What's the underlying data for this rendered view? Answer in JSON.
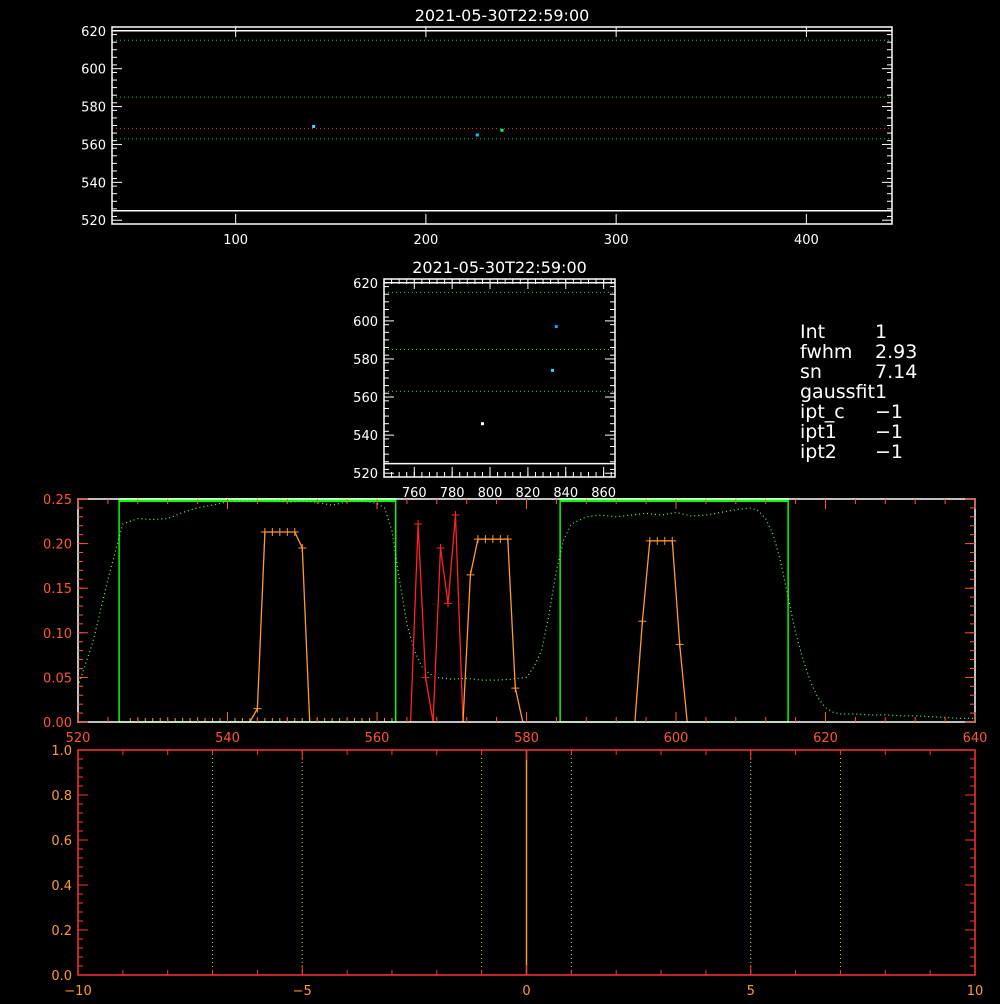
{
  "chart_data": [
    {
      "type": "scatter",
      "title": "2021-05-30T22:59:00",
      "xlim": [
        35,
        445
      ],
      "ylim": [
        518,
        622
      ],
      "xticks": [
        100,
        200,
        300,
        400
      ],
      "yticks": [
        520,
        540,
        560,
        580,
        600,
        620
      ],
      "frame_color": "#ffffff",
      "hlines": [
        {
          "y": 615,
          "color": "#00cc44",
          "style": "dotted"
        },
        {
          "y": 585,
          "color": "#00cc44",
          "style": "dotted"
        },
        {
          "y": 568.5,
          "color": "#ff3333",
          "style": "dotted"
        },
        {
          "y": 563,
          "color": "#00cc44",
          "style": "dotted"
        },
        {
          "y": 620,
          "color": "#ffffff",
          "style": "solid"
        },
        {
          "y": 525,
          "color": "#ffffff",
          "style": "solid"
        }
      ],
      "points": [
        {
          "x": 141,
          "y": 569.5,
          "color": "#66ccff"
        },
        {
          "x": 227,
          "y": 565,
          "color": "#00ccff"
        },
        {
          "x": 240,
          "y": 567.5,
          "color": "#00ff66"
        }
      ]
    },
    {
      "type": "scatter",
      "title": "2021-05-30T22:59:00",
      "xlim": [
        744,
        866
      ],
      "ylim": [
        518,
        622
      ],
      "xticks": [
        760,
        780,
        800,
        820,
        840,
        860
      ],
      "yticks": [
        520,
        540,
        560,
        580,
        600,
        620
      ],
      "frame_color": "#ffffff",
      "hlines": [
        {
          "y": 615,
          "color": "#00cc44",
          "style": "dotted"
        },
        {
          "y": 585,
          "color": "#00cc44",
          "style": "dotted"
        },
        {
          "y": 563,
          "color": "#00cc44",
          "style": "dotted"
        },
        {
          "y": 620,
          "color": "#ffffff",
          "style": "solid"
        },
        {
          "y": 525,
          "color": "#ffffff",
          "style": "solid"
        }
      ],
      "points": [
        {
          "x": 835,
          "y": 597,
          "color": "#3399ff"
        },
        {
          "x": 833,
          "y": 574,
          "color": "#33ccff"
        },
        {
          "x": 796,
          "y": 546,
          "color": "#ffffff"
        }
      ]
    },
    {
      "type": "line",
      "xlim": [
        520,
        640
      ],
      "ylim": [
        0,
        0.25
      ],
      "xticks": [
        520,
        540,
        560,
        580,
        600,
        620,
        640
      ],
      "yticks": [
        0.0,
        0.05,
        0.1,
        0.15,
        0.2,
        0.25
      ],
      "ytick_labels": [
        "0.00",
        "0.05",
        "0.10",
        "0.15",
        "0.20",
        "0.25"
      ],
      "frame_color": "#ffffff",
      "axis_color": "#ff5533",
      "boxes": [
        {
          "x0": 525.5,
          "x1": 562.5,
          "color": "#00ff00"
        },
        {
          "x0": 584.5,
          "x1": 615,
          "color": "#00ff00"
        }
      ],
      "series": [
        {
          "style": "dotted",
          "color": "#66ff66",
          "x": [
            520,
            522,
            524,
            526,
            528,
            530,
            532,
            534,
            536,
            538,
            540,
            542,
            544,
            546,
            548,
            550,
            552,
            554,
            556,
            558,
            560,
            561,
            562,
            563,
            564,
            565,
            566,
            567,
            568,
            570,
            572,
            574,
            576,
            578,
            580,
            581,
            582,
            583,
            584,
            585,
            586,
            588,
            590,
            592,
            594,
            596,
            598,
            600,
            602,
            604,
            606,
            608,
            610,
            611,
            612,
            613,
            614,
            615,
            616,
            617,
            618,
            619,
            620,
            621,
            622,
            624,
            626,
            628,
            630,
            632,
            634,
            636,
            638,
            640
          ],
          "y": [
            0.04,
            0.09,
            0.16,
            0.222,
            0.228,
            0.227,
            0.228,
            0.235,
            0.24,
            0.243,
            0.247,
            0.248,
            0.249,
            0.249,
            0.246,
            0.248,
            0.246,
            0.243,
            0.247,
            0.248,
            0.245,
            0.24,
            0.215,
            0.16,
            0.11,
            0.08,
            0.062,
            0.054,
            0.05,
            0.048,
            0.049,
            0.047,
            0.047,
            0.048,
            0.05,
            0.062,
            0.08,
            0.12,
            0.17,
            0.205,
            0.222,
            0.23,
            0.232,
            0.23,
            0.232,
            0.234,
            0.232,
            0.235,
            0.231,
            0.232,
            0.235,
            0.238,
            0.24,
            0.237,
            0.228,
            0.21,
            0.18,
            0.14,
            0.1,
            0.07,
            0.045,
            0.027,
            0.016,
            0.011,
            0.009,
            0.009,
            0.008,
            0.008,
            0.007,
            0.007,
            0.006,
            0.005,
            0.004,
            0.004
          ]
        },
        {
          "style": "solid",
          "color": "#ff9933",
          "markers": true,
          "x": [
            543,
            544,
            545,
            546,
            547,
            548,
            549,
            550,
            551
          ],
          "y": [
            0,
            0.015,
            0.213,
            0.213,
            0.213,
            0.213,
            0.213,
            0.195,
            0
          ],
          "marker_idx": [
            1,
            2,
            3,
            4,
            5,
            6,
            7
          ]
        },
        {
          "style": "solid",
          "color": "#ff2222",
          "markers": true,
          "x": [
            564.5,
            565.5,
            566.5,
            567.5,
            568.5,
            569.5,
            570.5,
            571.5
          ],
          "y": [
            0,
            0.222,
            0.05,
            0,
            0.195,
            0.133,
            0.232,
            0
          ],
          "marker_idx": [
            1,
            2,
            4,
            5,
            6
          ]
        },
        {
          "style": "solid",
          "color": "#ff9933",
          "markers": true,
          "x": [
            571.5,
            572.5,
            573.5,
            574.5,
            575.5,
            576.5,
            577.5,
            578.5,
            579.5
          ],
          "y": [
            0,
            0.165,
            0.205,
            0.205,
            0.205,
            0.205,
            0.205,
            0.038,
            0
          ],
          "marker_idx": [
            1,
            2,
            3,
            4,
            5,
            6,
            7
          ]
        },
        {
          "style": "solid",
          "color": "#ff9933",
          "markers": true,
          "x": [
            594.5,
            595.5,
            596.5,
            597.5,
            598.5,
            599.5,
            600.5,
            601.5
          ],
          "y": [
            0,
            0.113,
            0.203,
            0.203,
            0.203,
            0.203,
            0.087,
            0
          ],
          "marker_idx": [
            1,
            2,
            3,
            4,
            5,
            6
          ]
        }
      ],
      "baseline_ticks": {
        "x0": 527,
        "x1": 562,
        "step": 1,
        "color": "#ff9933"
      }
    },
    {
      "type": "line",
      "xlim": [
        -10,
        10
      ],
      "ylim": [
        0,
        1.0
      ],
      "xticks": [
        -10,
        -5,
        0,
        5,
        10
      ],
      "yticks": [
        0.0,
        0.2,
        0.4,
        0.6,
        0.8,
        1.0
      ],
      "ytick_labels": [
        "0.0",
        "0.2",
        "0.4",
        "0.6",
        "0.8",
        "1.0"
      ],
      "frame_color": "#ff3333",
      "label_color": "#ff9933",
      "vlines": [
        {
          "x": -7,
          "color": "#cccc66",
          "style": "dotted"
        },
        {
          "x": -5,
          "color": "#cccc66",
          "style": "dotted"
        },
        {
          "x": -1,
          "color": "#cccc66",
          "style": "dotted"
        },
        {
          "x": 0,
          "color": "#ff9933",
          "style": "solid"
        },
        {
          "x": 1,
          "color": "#cccc66",
          "style": "dotted"
        },
        {
          "x": 5,
          "color": "#cccc66",
          "style": "dotted"
        },
        {
          "x": 7,
          "color": "#cccc66",
          "style": "dotted"
        }
      ]
    }
  ],
  "info": [
    {
      "key": "Int",
      "value": "1"
    },
    {
      "key": "fwhm",
      "value": "2.93"
    },
    {
      "key": "sn",
      "value": "7.14"
    },
    {
      "key": "gaussfit",
      "value": "1"
    },
    {
      "key": "ipt_c",
      "value": "−1"
    },
    {
      "key": "ipt1",
      "value": "−1"
    },
    {
      "key": "ipt2",
      "value": "−1"
    }
  ]
}
